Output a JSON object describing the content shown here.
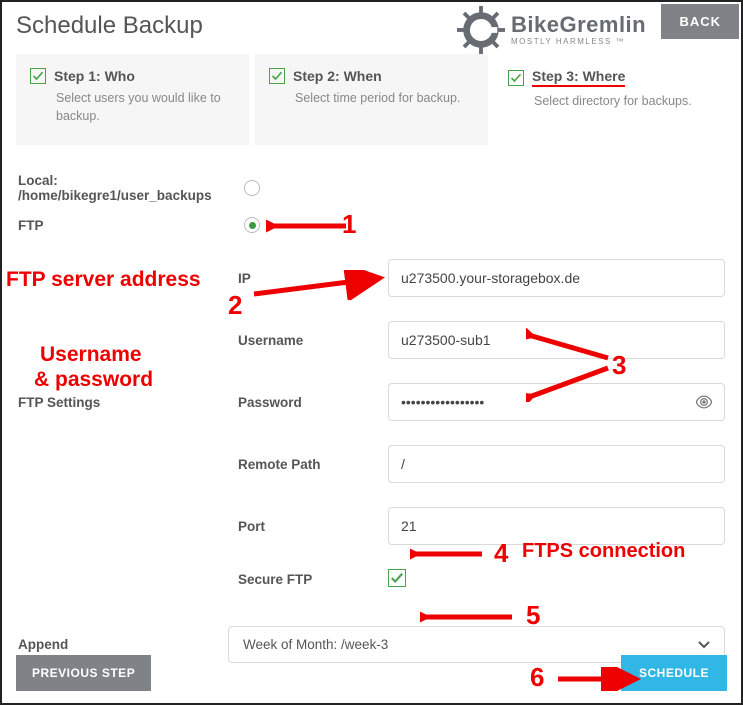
{
  "header": {
    "title": "Schedule Backup",
    "back_label": "BACK",
    "brand_name": "BikeGremlin",
    "brand_tagline": "MOSTLY HARMLESS ™"
  },
  "steps": [
    {
      "title": "Step 1: Who",
      "desc": "Select users you would like to backup."
    },
    {
      "title": "Step 2: When",
      "desc": "Select time period for backup."
    },
    {
      "title": "Step 3: Where",
      "desc": "Select directory for backups."
    }
  ],
  "destinations": {
    "local": {
      "label": "Local: /home/bikegre1/user_backups",
      "selected": false
    },
    "ftp": {
      "label": "FTP",
      "selected": true
    }
  },
  "ftp": {
    "section_label": "FTP Settings",
    "ip": {
      "label": "IP",
      "value": "u273500.your-storagebox.de"
    },
    "username": {
      "label": "Username",
      "value": "u273500-sub1"
    },
    "password": {
      "label": "Password",
      "value": "•••••••••••••••••"
    },
    "remote_path": {
      "label": "Remote Path",
      "value": "/"
    },
    "port": {
      "label": "Port",
      "value": "21"
    },
    "secure": {
      "label": "Secure FTP",
      "checked": true
    }
  },
  "append": {
    "label": "Append",
    "value": "Week of Month: /week-3"
  },
  "footer": {
    "prev_label": "PREVIOUS STEP",
    "schedule_label": "SCHEDULE"
  },
  "annotations": {
    "a1": "1",
    "a2_label": "FTP server address",
    "a2": "2",
    "a3_label1": "Username",
    "a3_label2": "& password",
    "a3": "3",
    "a4": "4",
    "a4_label": "FTPS connection",
    "a5": "5",
    "a6": "6"
  }
}
